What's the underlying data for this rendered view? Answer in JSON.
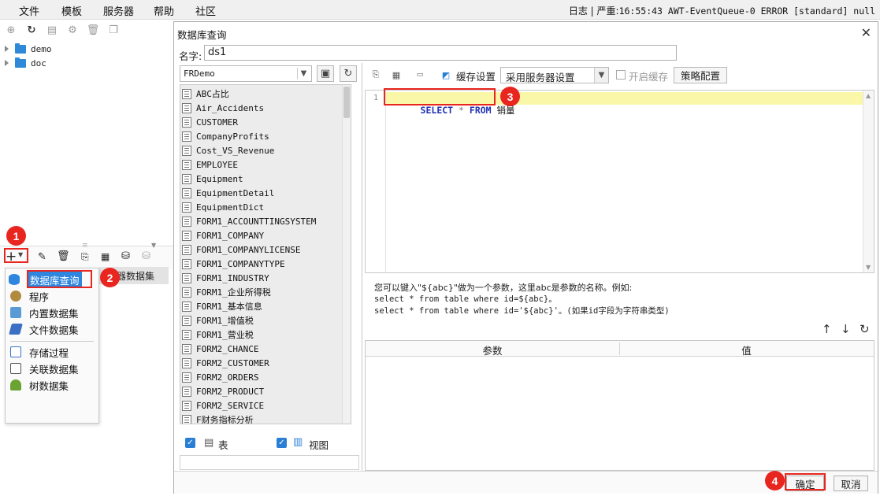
{
  "menubar": {
    "items": [
      "文件",
      "模板",
      "服务器",
      "帮助",
      "社区"
    ],
    "status_prefix": "日志 | 严重:",
    "status_log": "16:55:43 AWT-EventQueue-0 ERROR [standard] null"
  },
  "tree": {
    "items": [
      "demo",
      "doc"
    ]
  },
  "dataset_menu": {
    "items": [
      "数据库查询",
      "程序",
      "内置数据集",
      "文件数据集",
      "存储过程",
      "关联数据集",
      "树数据集"
    ],
    "behind_row_label": "器数据集"
  },
  "dialog": {
    "title": "数据库查询",
    "close_glyph": "✕",
    "name_label": "名字:",
    "name_value": "ds1",
    "connection": "FRDemo",
    "tables": [
      "ABC占比",
      "Air_Accidents",
      "CUSTOMER",
      "CompanyProfits",
      "Cost_VS_Revenue",
      "EMPLOYEE",
      "Equipment",
      "EquipmentDetail",
      "EquipmentDict",
      "FORM1_ACCOUNTTINGSYSTEM",
      "FORM1_COMPANY",
      "FORM1_COMPANYLICENSE",
      "FORM1_COMPANYTYPE",
      "FORM1_INDUSTRY",
      "FORM1_企业所得税",
      "FORM1_基本信息",
      "FORM1_增值税",
      "FORM1_营业税",
      "FORM2_CHANCE",
      "FORM2_CUSTOMER",
      "FORM2_ORDERS",
      "FORM2_PRODUCT",
      "FORM2_SERVICE",
      "F财务指标分析"
    ],
    "check_table_label": "表",
    "check_view_label": "视图",
    "cache_settings_label": "缓存设置",
    "cache_option": "采用服务器设置",
    "enable_cache_label": "开启缓存",
    "strategy_label": "策略配置",
    "line_number": "1",
    "sql": {
      "kw1": "SELECT",
      "op": "*",
      "kw2": "FROM",
      "table": "销量"
    },
    "hint_line1": "您可以键入\"${abc}\"做为一个参数，这里abc是参数的名称。例如:",
    "hint_line2": "select * from table where id=${abc}。",
    "hint_line3": "select * from table where id='${abc}'。(如果id字段为字符串类型)",
    "param_col": "参数",
    "value_col": "值",
    "ok_label": "确定",
    "cancel_label": "取消"
  },
  "badges": [
    "1",
    "2",
    "3",
    "4"
  ],
  "colors": {
    "accent": "#2a7fd4",
    "highlight": "#e8261f",
    "selected_item": "#2f86de",
    "current_line": "#fbf7a8"
  }
}
